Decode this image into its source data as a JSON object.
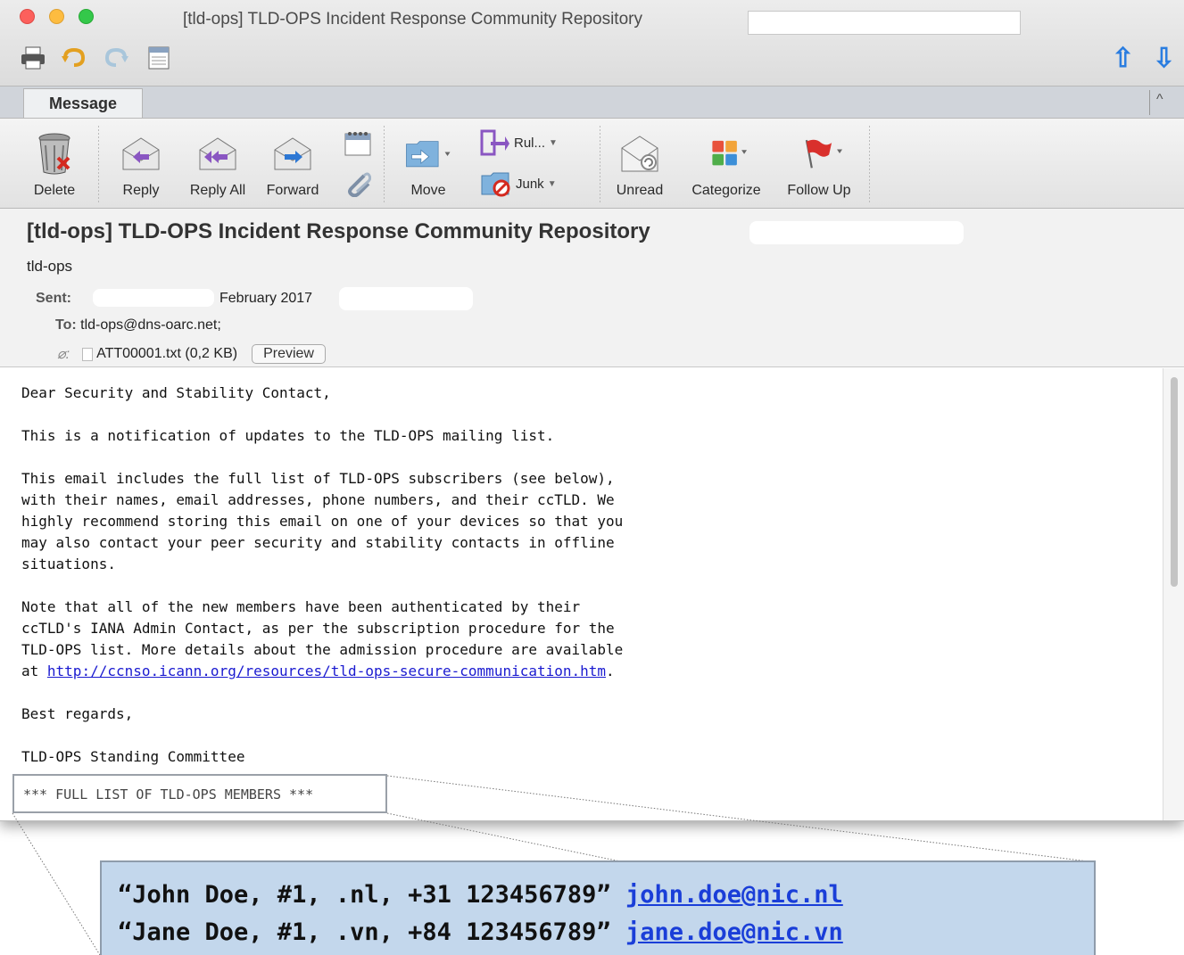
{
  "window": {
    "title": "[tld-ops] TLD-OPS Incident Response Community Repository"
  },
  "ribbon": {
    "tab": "Message",
    "delete": "Delete",
    "reply": "Reply",
    "reply_all": "Reply All",
    "forward": "Forward",
    "move": "Move",
    "rules": "Rul...",
    "junk": "Junk",
    "unread": "Unread",
    "categorize": "Categorize",
    "follow_up": "Follow Up"
  },
  "header": {
    "subject": "[tld-ops] TLD-OPS Incident Response Community Repository",
    "sender": "tld-ops",
    "sent_label": "Sent:",
    "sent_value": "February 2017",
    "to_label": "To:",
    "to_value": "tld-ops@dns-oarc.net;",
    "attachment_name": "ATT00001.txt (0,2 KB)",
    "preview_label": "Preview"
  },
  "body": {
    "greeting": "Dear Security and Stability Contact,",
    "para1": "This is a notification of updates to the TLD-OPS mailing list.",
    "para2_lines": [
      "This email includes the full list of TLD-OPS subscribers (see below),",
      "with their names, email addresses, phone numbers, and their ccTLD. We",
      "highly recommend storing this email on one of your devices so that you",
      "may also contact your peer security and stability contacts in offline",
      "situations."
    ],
    "para3_lines": [
      "Note that all of the new members have been authenticated by their",
      "ccTLD's IANA Admin Contact, as per the subscription procedure for the",
      "TLD-OPS list. More details about the admission procedure are available"
    ],
    "para3_link_prefix": "at ",
    "para3_link": "http://ccnso.icann.org/resources/tld-ops-secure-communication.htm",
    "para3_link_suffix": ".",
    "regards": "Best regards,",
    "signature": "TLD-OPS Standing Committee",
    "members_heading": "*** FULL LIST OF TLD-OPS MEMBERS ***"
  },
  "callout": {
    "entries": [
      {
        "text": "“John Doe, #1, .nl, +31 123456789”",
        "email": "john.doe@nic.nl"
      },
      {
        "text": "“Jane Doe, #1, .vn, +84 123456789”",
        "email": "jane.doe@nic.vn"
      }
    ]
  },
  "colors": {
    "callout_bg": "#c3d7ec",
    "link": "#1a1ad0",
    "flag": "#d9302c",
    "nav_arrow": "#2a7de0"
  }
}
